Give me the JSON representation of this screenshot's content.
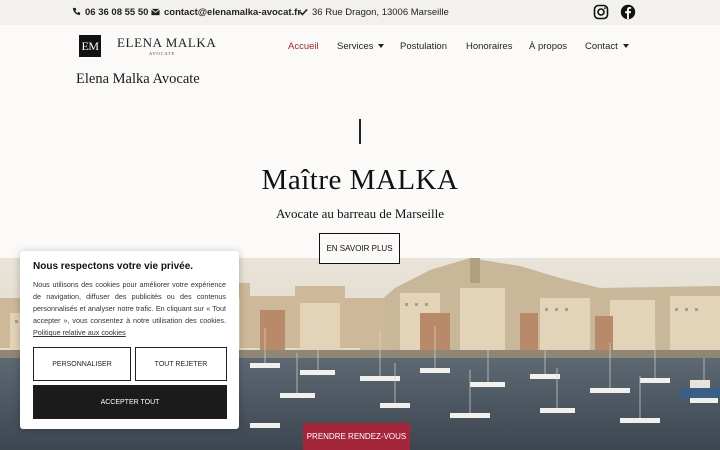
{
  "topbar": {
    "phone": "06 36 08 55 50",
    "email": "contact@elenamalka-avocat.fr",
    "address": "36 Rue Dragon, 13006 Marseille",
    "icons": {
      "phone": "phone-icon",
      "email": "envelope-icon",
      "address": "check-icon",
      "instagram": "instagram-icon",
      "facebook": "facebook-icon"
    }
  },
  "header": {
    "logo_mark": "EM",
    "logo_name": "ELENA MALKA",
    "logo_sub": "AVOCATE",
    "site_title": "Elena Malka Avocate"
  },
  "nav": {
    "items": [
      {
        "label": "Accueil",
        "active": true,
        "dropdown": false
      },
      {
        "label": "Services",
        "active": false,
        "dropdown": true
      },
      {
        "label": "Postulation",
        "active": false,
        "dropdown": false
      },
      {
        "label": "Honoraires",
        "active": false,
        "dropdown": false
      },
      {
        "label": "À propos",
        "active": false,
        "dropdown": false
      },
      {
        "label": "Contact",
        "active": false,
        "dropdown": true
      }
    ]
  },
  "hero": {
    "title": "Maître MALKA",
    "subtitle": "Avocate au barreau de Marseille",
    "cta": "EN SAVOIR PLUS"
  },
  "appointment_button": "PRENDRE RENDEZ-VOUS",
  "cookie": {
    "title": "Nous respectons votre vie privée.",
    "text": "Nous utilisons des cookies pour améliorer votre expérience de navigation, diffuser des publicités ou des contenus personnalisés et analyser notre trafic. En cliquant sur « Tout accepter », vous consentez à notre utilisation des cookies.",
    "policy_link": "Politique relative aux cookies",
    "customize": "PERSONNALISER",
    "reject": "TOUT REJETER",
    "accept": "ACCEPTER TOUT"
  },
  "colors": {
    "accent": "#9c2a2a",
    "cta_red": "#a4263a",
    "topbar_bg": "#f3f1ee",
    "page_bg": "#fbfaf8"
  }
}
